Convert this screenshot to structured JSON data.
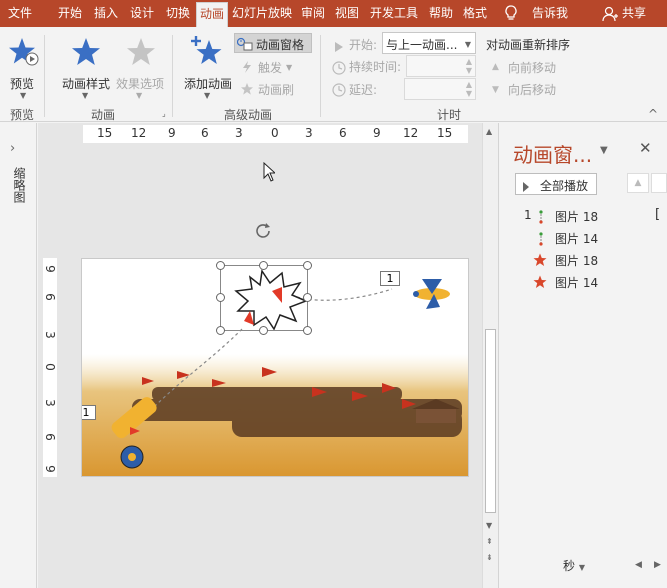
{
  "colors": {
    "accent": "#b7472a",
    "tab_text": "#ffffff",
    "disabled": "#a8a8a8",
    "star_blue": "#3a6fc4",
    "star_red": "#d9472b"
  },
  "tabs": [
    {
      "label": "文件"
    },
    {
      "label": "开始"
    },
    {
      "label": "插入"
    },
    {
      "label": "设计"
    },
    {
      "label": "切换"
    },
    {
      "label": "动画"
    },
    {
      "label": "幻灯片放映"
    },
    {
      "label": "审阅"
    },
    {
      "label": "视图"
    },
    {
      "label": "开发工具"
    },
    {
      "label": "帮助"
    },
    {
      "label": "格式"
    }
  ],
  "tell_me": "告诉我",
  "share": "共享",
  "ribbon": {
    "preview": {
      "label": "预览",
      "group": "预览"
    },
    "animation": {
      "style_label": "动画样式",
      "effects_label": "效果选项",
      "group": "动画"
    },
    "advanced": {
      "add_label": "添加动画",
      "pane_label": "动画窗格",
      "trigger_label": "触发",
      "painter_label": "动画刷",
      "group": "高级动画"
    },
    "timing": {
      "start_label": "开始:",
      "start_value": "与上一动画...",
      "duration_label": "持续时间:",
      "delay_label": "延迟:",
      "group": "计时"
    },
    "reorder": {
      "title": "对动画重新排序",
      "forward": "向前移动",
      "backward": "向后移动"
    }
  },
  "left_strip": {
    "label": "缩略图"
  },
  "ruler": {
    "h": [
      "15",
      "12",
      "9",
      "6",
      "3",
      "0",
      "3",
      "6",
      "9",
      "12",
      "15"
    ],
    "v": [
      "9",
      "6",
      "3",
      "0",
      "3",
      "6",
      "9"
    ]
  },
  "slide": {
    "tag_plane": "1",
    "tag_cannon": "1"
  },
  "pane": {
    "title": "动画窗...",
    "play_all": "全部播放",
    "items": [
      {
        "num": "1",
        "icon": "path-icon",
        "name": "图片 18"
      },
      {
        "num": "",
        "icon": "path-icon",
        "name": "图片 14"
      },
      {
        "num": "",
        "icon": "star-icon",
        "name": "图片 18"
      },
      {
        "num": "",
        "icon": "star-icon",
        "name": "图片 14"
      }
    ],
    "seconds": "秒"
  }
}
